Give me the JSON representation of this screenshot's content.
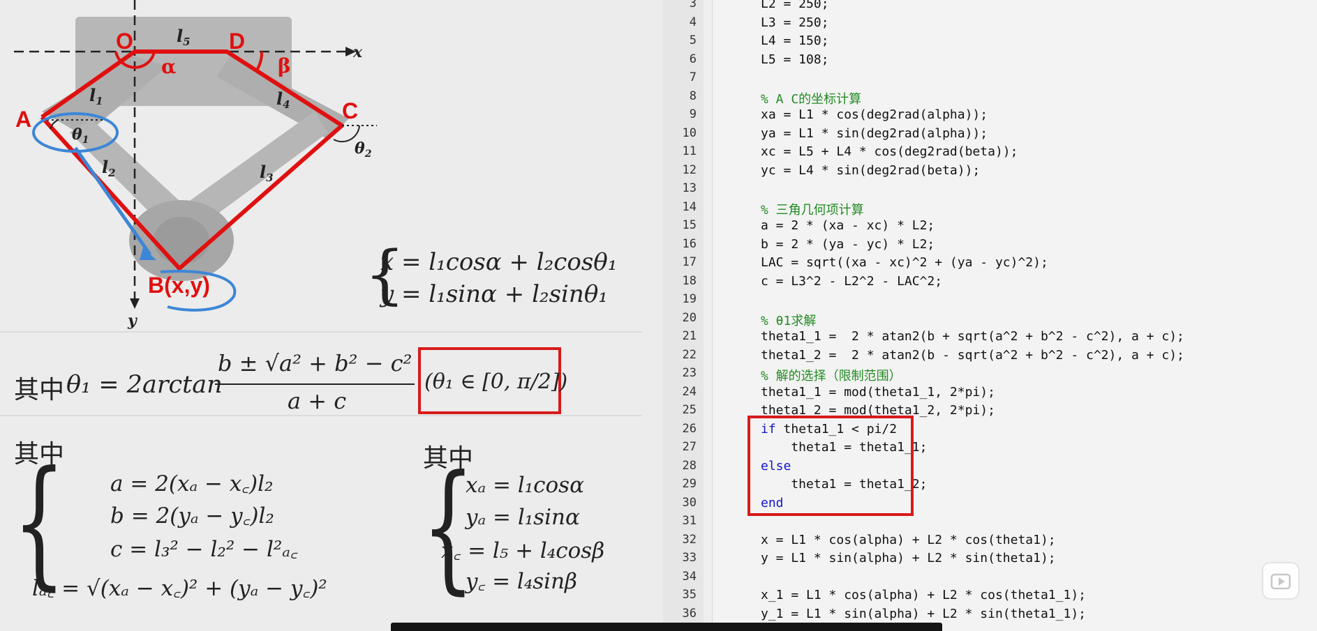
{
  "diagram": {
    "points": {
      "O": "O",
      "D": "D",
      "A": "A",
      "C": "C",
      "B": "B(x,y)"
    },
    "links": {
      "l1": "l",
      "l1_sub": "1",
      "l2": "l",
      "l2_sub": "2",
      "l3": "l",
      "l3_sub": "3",
      "l4": "l",
      "l4_sub": "4",
      "l5": "l",
      "l5_sub": "5"
    },
    "angles": {
      "alpha": "α",
      "beta": "β",
      "theta1": "θ",
      "theta1_sub": "1",
      "theta2": "θ",
      "theta2_sub": "2"
    },
    "axes": {
      "x": "x",
      "y": "y"
    }
  },
  "equations": {
    "system_line1": "x = l₁cosα + l₂cosθ₁",
    "system_line2": "y = l₁sinα + l₂sinθ₁",
    "theta_prefix": "其中",
    "theta_lhs": "θ₁ = 2arctan",
    "theta_num": "b ± √a² + b² − c²",
    "theta_den": "a + c",
    "theta_range": "(θ₁ ∈ [0, π/2])",
    "where1_label": "其中",
    "where1": [
      "a = 2(xₐ − x꜀)l₂",
      "b = 2(yₐ − y꜀)l₂",
      "c = l₃² − l₂² − l²ₐ꜀",
      "lₐ꜀ = √(xₐ − x꜀)² + (yₐ − y꜀)²"
    ],
    "where2_label": "其中",
    "where2": [
      "xₐ = l₁cosα",
      "yₐ = l₁sinα",
      "x꜀ = l₅ + l₄cosβ",
      "y꜀ = l₄sinβ"
    ]
  },
  "editor": {
    "lines": [
      {
        "n": "3",
        "text": "L2 = 250;"
      },
      {
        "n": "4",
        "text": "L3 = 250;"
      },
      {
        "n": "5",
        "text": "L4 = 150;"
      },
      {
        "n": "6",
        "text": "L5 = 108;"
      },
      {
        "n": "7",
        "text": ""
      },
      {
        "n": "8",
        "text": "% A C的坐标计算",
        "type": "comment"
      },
      {
        "n": "9",
        "text": "xa = L1 * cos(deg2rad(alpha));"
      },
      {
        "n": "10",
        "text": "ya = L1 * sin(deg2rad(alpha));"
      },
      {
        "n": "11",
        "text": "xc = L5 + L4 * cos(deg2rad(beta));"
      },
      {
        "n": "12",
        "text": "yc = L4 * sin(deg2rad(beta));"
      },
      {
        "n": "13",
        "text": ""
      },
      {
        "n": "14",
        "text": "% 三角几何项计算",
        "type": "comment"
      },
      {
        "n": "15",
        "text": "a = 2 * (xa - xc) * L2;"
      },
      {
        "n": "16",
        "text": "b = 2 * (ya - yc) * L2;"
      },
      {
        "n": "17",
        "text": "LAC = sqrt((xa - xc)^2 + (ya - yc)^2);"
      },
      {
        "n": "18",
        "text": "c = L3^2 - L2^2 - LAC^2;"
      },
      {
        "n": "19",
        "text": ""
      },
      {
        "n": "20",
        "text": "% θ1求解",
        "type": "comment"
      },
      {
        "n": "21",
        "text": "theta1_1 =  2 * atan2(b + sqrt(a^2 + b^2 - c^2), a + c);"
      },
      {
        "n": "22",
        "text": "theta1_2 =  2 * atan2(b - sqrt(a^2 + b^2 - c^2), a + c);"
      },
      {
        "n": "23",
        "text": "% 解的选择（限制范围）",
        "type": "comment"
      },
      {
        "n": "24",
        "text": "theta1_1 = mod(theta1_1, 2*pi);"
      },
      {
        "n": "25",
        "text": "theta1_2 = mod(theta1_2, 2*pi);"
      },
      {
        "n": "26",
        "kw": "if",
        "text": " theta1_1 < pi/2"
      },
      {
        "n": "27",
        "text": "    theta1 = theta1_1;"
      },
      {
        "n": "28",
        "kw": "else",
        "text": ""
      },
      {
        "n": "29",
        "text": "    theta1 = theta1_2;"
      },
      {
        "n": "30",
        "kw": "end",
        "text": ""
      },
      {
        "n": "31",
        "text": ""
      },
      {
        "n": "32",
        "text": "x = L1 * cos(alpha) + L2 * cos(theta1);"
      },
      {
        "n": "33",
        "text": "y = L1 * sin(alpha) + L2 * sin(theta1);"
      },
      {
        "n": "34",
        "text": ""
      },
      {
        "n": "35",
        "text": "x_1 = L1 * cos(alpha) + L2 * cos(theta1_1);"
      },
      {
        "n": "36",
        "text": "y_1 = L1 * sin(alpha) + L2 * sin(theta1_1);"
      }
    ]
  },
  "colors": {
    "highlight": "#d81a1a",
    "comment": "#228b22",
    "keyword": "#1414c8",
    "annotation_blue": "#3d86d6"
  },
  "icons": {
    "play": "play-icon"
  }
}
